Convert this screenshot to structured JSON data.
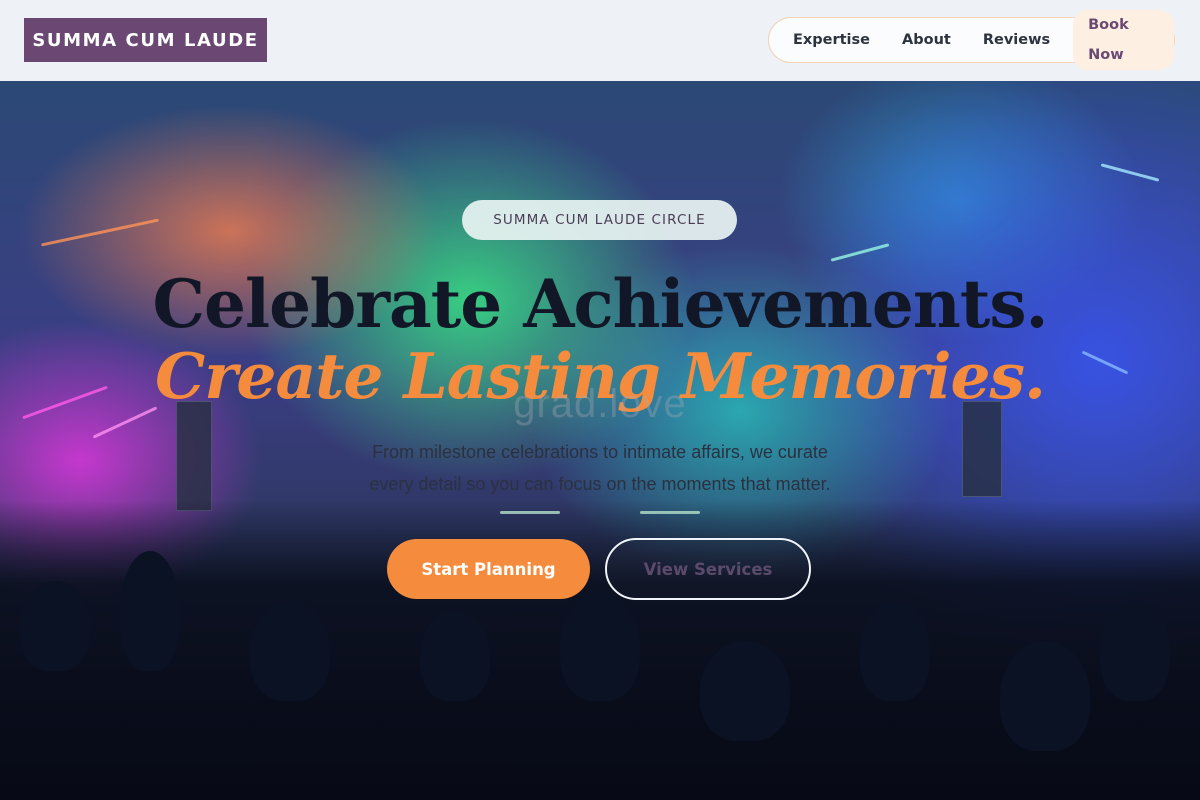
{
  "brand": {
    "name": "SUMMA CUM LAUDE"
  },
  "nav": {
    "links": [
      "Expertise",
      "About",
      "Reviews"
    ],
    "cta": "Book Now"
  },
  "hero": {
    "badge": "SUMMA CUM LAUDE CIRCLE",
    "title_line1": "Celebrate Achievements.",
    "title_line2": "Create Lasting Memories.",
    "watermark": "grad.love",
    "subtitle_line1": "From milestone celebrations to intimate affairs, we curate",
    "subtitle_line2": "every detail so you can focus on the moments that matter.",
    "primary_button": "Start Planning",
    "secondary_button": "View Services"
  },
  "colors": {
    "brand_bg": "#6a4873",
    "accent_orange": "#f58c3d",
    "title_dark": "#121727",
    "nav_bg": "#eef1f6"
  }
}
